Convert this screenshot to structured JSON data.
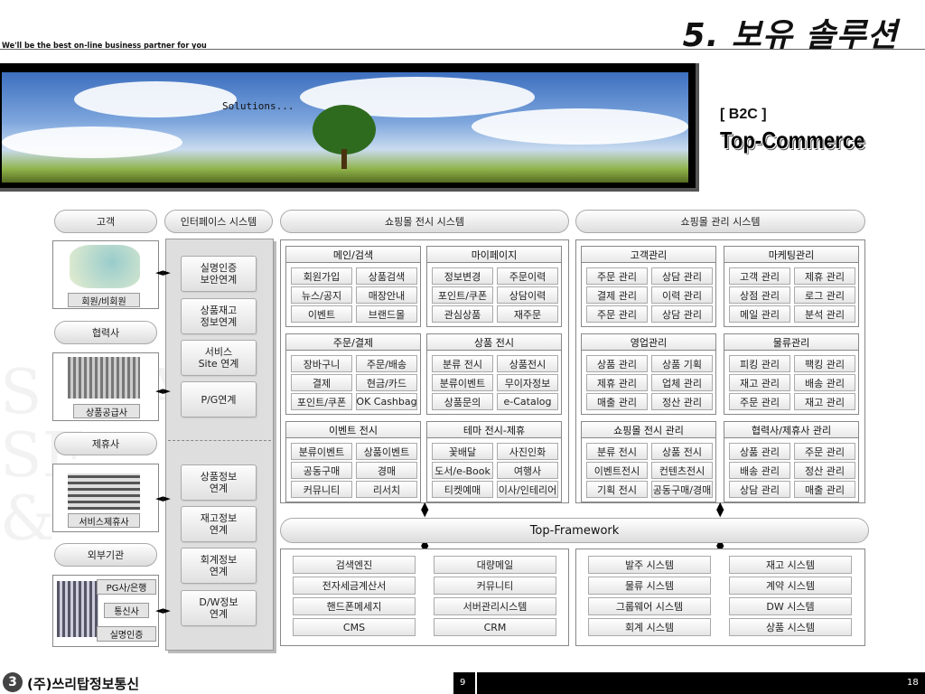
{
  "header": {
    "title": "5. 보유 솔루션",
    "tagline": "We'll be the best on-line business partner for you"
  },
  "hero": {
    "caption": "Solutions...",
    "b2c": "[ B2C ]",
    "product": "Top-Commerce"
  },
  "columns": {
    "customer": "고객",
    "interface": "인터페이스 시스템",
    "mall_display": "쇼핑몰 전시 시스템",
    "mall_manage": "쇼핑몰 관리 시스템"
  },
  "left": {
    "member": "회원/비회원",
    "partner_pill": "협력사",
    "supplier": "상품공급사",
    "affiliate_pill": "제휴사",
    "affiliate": "서비스제휴사",
    "external_pill": "외부기관",
    "external": [
      "PG사/은행",
      "통신사",
      "실명인증"
    ]
  },
  "interface": [
    "실명인증\n보안연계",
    "상품재고\n정보연계",
    "서비스\nSite 연계",
    "P/G연계",
    "상품정보\n연계",
    "재고정보\n연계",
    "회계정보\n연계",
    "D/W정보\n연계"
  ],
  "display": [
    {
      "title": "메인/검색",
      "items": [
        "회원가입",
        "상품검색",
        "뉴스/공지",
        "매장안내",
        "이벤트",
        "브랜드몰"
      ]
    },
    {
      "title": "마이페이지",
      "items": [
        "정보변경",
        "주문이력",
        "포인트/쿠폰",
        "상담이력",
        "관심상품",
        "재주문"
      ]
    },
    {
      "title": "주문/결제",
      "items": [
        "장바구니",
        "주문/배송",
        "결제",
        "현금/카드",
        "포인트/쿠폰",
        "OK Cashbag"
      ]
    },
    {
      "title": "상품 전시",
      "items": [
        "분류 전시",
        "상품전시",
        "분류이벤트",
        "무이자정보",
        "상품문의",
        "e-Catalog"
      ]
    },
    {
      "title": "이벤트 전시",
      "items": [
        "분류이벤트",
        "상품이벤트",
        "공동구매",
        "경매",
        "커뮤니티",
        "리서치"
      ]
    },
    {
      "title": "테마 전시-제휴",
      "items": [
        "꽃배달",
        "사진인화",
        "도서/e-Book",
        "여행사",
        "티켓예매",
        "이사/인테리어"
      ]
    }
  ],
  "manage": [
    {
      "title": "고객관리",
      "items": [
        "주문 관리",
        "상담 관리",
        "결제 관리",
        "이력 관리",
        "주문 관리",
        "상담 관리"
      ]
    },
    {
      "title": "마케팅관리",
      "items": [
        "고객 관리",
        "제휴 관리",
        "상점 관리",
        "로그 관리",
        "메일 관리",
        "분석 관리"
      ]
    },
    {
      "title": "영업관리",
      "items": [
        "상품 관리",
        "상품 기획",
        "제휴 관리",
        "업체 관리",
        "매출 관리",
        "정산 관리"
      ]
    },
    {
      "title": "물류관리",
      "items": [
        "피킹 관리",
        "팩킹 관리",
        "재고 관리",
        "배송 관리",
        "주문 관리",
        "재고 관리"
      ]
    },
    {
      "title": "쇼핑몰 전시 관리",
      "items": [
        "분류 전시",
        "상품 전시",
        "이벤트전시",
        "컨텐츠전시",
        "기획 전시",
        "공동구매/경매"
      ]
    },
    {
      "title": "협력사/제휴사 관리",
      "items": [
        "상품 관리",
        "주문 관리",
        "배송 관리",
        "정산 관리",
        "상담 관리",
        "매출 관리"
      ]
    }
  ],
  "framework": "Top-Framework",
  "bottom": [
    [
      "검색엔진",
      "전자세금계산서",
      "핸드폰메세지",
      "CMS"
    ],
    [
      "대량메일",
      "커뮤니티",
      "서버관리시스템",
      "CRM"
    ],
    [
      "발주 시스템",
      "물류 시스템",
      "그룹웨어 시스템",
      "회계 시스템"
    ],
    [
      "재고 시스템",
      "계약 시스템",
      "DW 시스템",
      "상품 시스템"
    ]
  ],
  "footer": {
    "company": "(주)쓰리탑정보통신",
    "logo": "3",
    "page": "9",
    "total": "18"
  }
}
